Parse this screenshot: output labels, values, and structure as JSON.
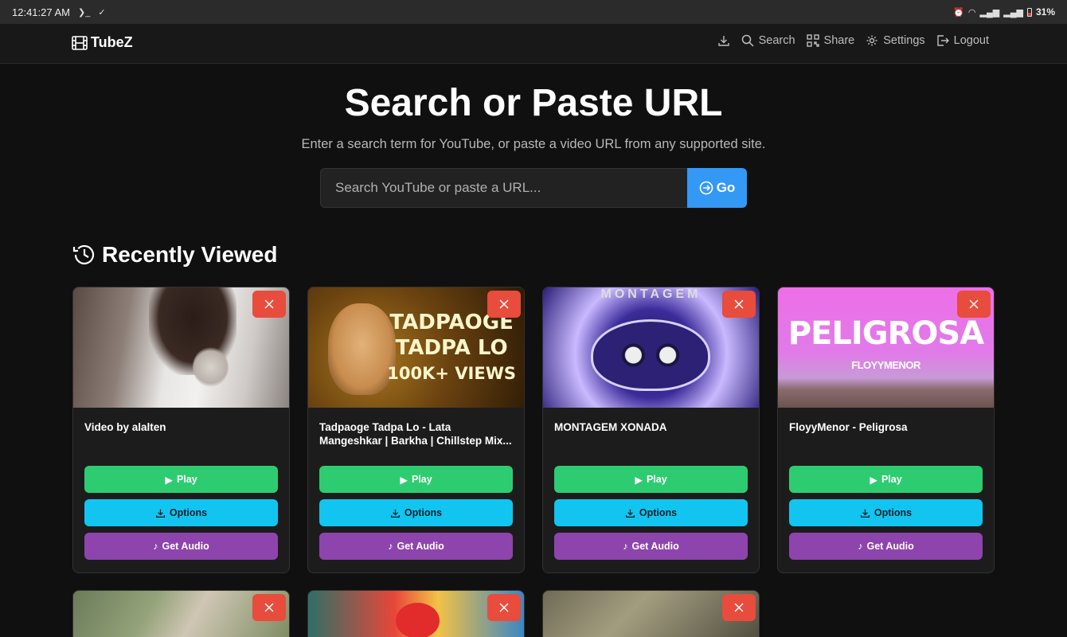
{
  "status_bar": {
    "time": "12:41:27 AM",
    "battery": "31%"
  },
  "navbar": {
    "brand": "TubeZ",
    "links": {
      "search": "Search",
      "share": "Share",
      "settings": "Settings",
      "logout": "Logout"
    }
  },
  "hero": {
    "title": "Search or Paste URL",
    "subtitle": "Enter a search term for YouTube, or paste a video URL from any supported site.",
    "search_placeholder": "Search YouTube or paste a URL...",
    "go_label": "Go"
  },
  "recent": {
    "heading": "Recently Viewed",
    "buttons": {
      "play": "Play",
      "options": "Options",
      "audio": "Get Audio"
    },
    "items": [
      {
        "title": "Video by alalten"
      },
      {
        "title": "Tadpaoge Tadpa Lo - Lata Mangeshkar | Barkha | Chillstep Mix...",
        "thumb_text": [
          "TADPAOGE",
          "TADPA LO",
          "100K+ VIEWS"
        ]
      },
      {
        "title": "MONTAGEM XONADA",
        "thumb_text": "MONTAGEM"
      },
      {
        "title": "FloyyMenor - Peligrosa",
        "thumb_text": [
          "PELIGROSA",
          "FLOYYMENOR"
        ]
      }
    ]
  },
  "colors": {
    "play": "#2ecc71",
    "options": "#12c5f0",
    "audio": "#8e44ad",
    "close": "#e74c3c",
    "go": "#3498f5"
  }
}
